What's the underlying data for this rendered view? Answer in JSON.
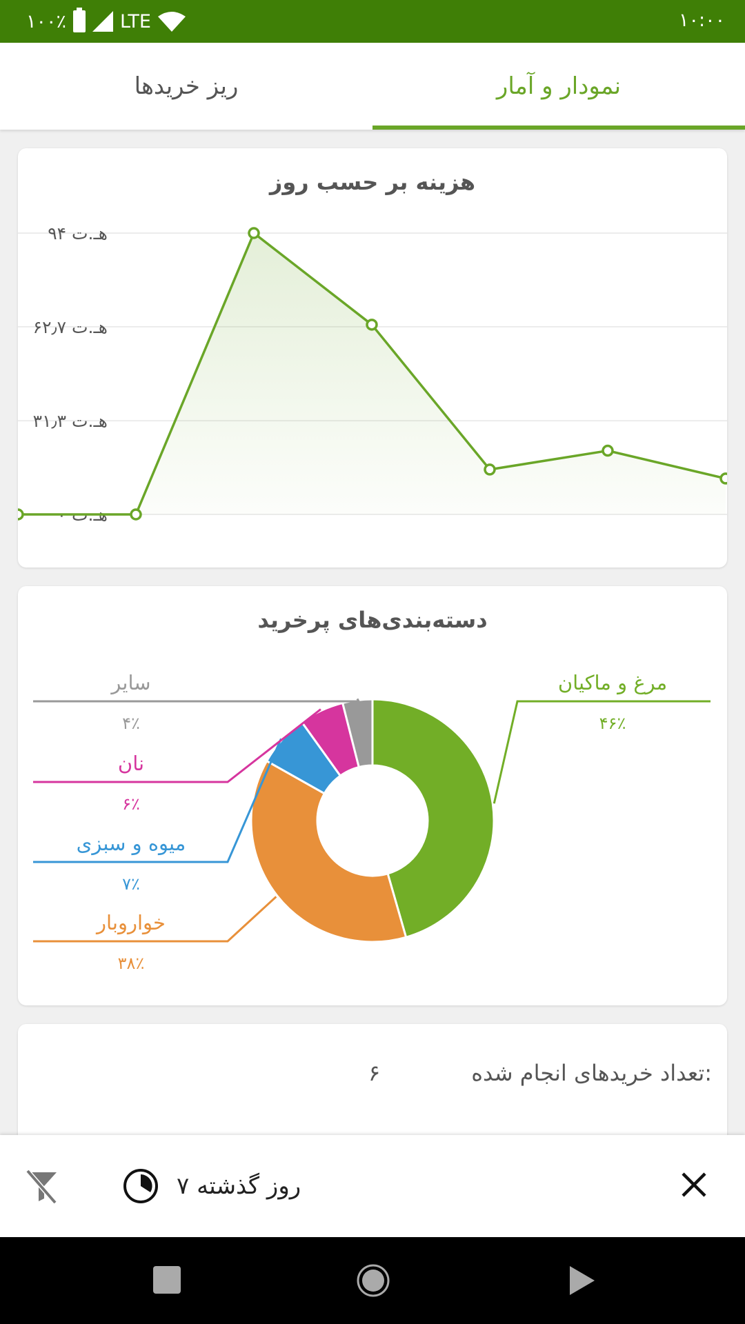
{
  "status_bar": {
    "time": "۱۰:۰۰",
    "battery": "۱۰۰٪",
    "network": "LTE"
  },
  "tabs": [
    {
      "label": "نمودار و آمار",
      "active": true
    },
    {
      "label": "ریز خریدها",
      "active": false
    }
  ],
  "line_card": {
    "title": "هزینه بر حسب روز"
  },
  "pie_card": {
    "title": "دسته‌بندی‌های پرخرید"
  },
  "chart_data": [
    {
      "type": "line",
      "title": "هزینه بر حسب روز",
      "ytick_labels": [
        "۰ هـ.ت",
        "۳۱٫۳ هـ.ت",
        "۶۲٫۷ هـ.ت",
        "۹۴ هـ.ت"
      ],
      "yticks": [
        0,
        31.3,
        62.7,
        94
      ],
      "ylim": [
        0,
        94
      ],
      "x": [
        1,
        2,
        3,
        4,
        5,
        6,
        7
      ],
      "values": [
        0,
        0,
        94,
        63.4,
        15,
        21.3,
        12
      ],
      "color": "#6aa628",
      "grid": true,
      "area_fill": true
    },
    {
      "type": "pie",
      "title": "دسته‌بندی‌های پرخرید",
      "donut": true,
      "slices": [
        {
          "label": "مرغ و ماکیان",
          "pct_label": "۴۶٪",
          "value": 46,
          "color": "#72ae27"
        },
        {
          "label": "خواروبار",
          "pct_label": "۳۸٪",
          "value": 38,
          "color": "#e8903a"
        },
        {
          "label": "میوه و سبزی",
          "pct_label": "۷٪",
          "value": 7,
          "color": "#3796d6"
        },
        {
          "label": "نان",
          "pct_label": "۶٪",
          "value": 6,
          "color": "#d6359e"
        },
        {
          "label": "سایر",
          "pct_label": "۴٪",
          "value": 4,
          "color": "#999999"
        }
      ]
    }
  ],
  "summary": {
    "label": "تعداد خریدهای انجام شده:",
    "value": "۶"
  },
  "filter_bar": {
    "period_label": "۷ روز گذشته"
  },
  "icons": {
    "filter_off": "filter-off-icon",
    "clock": "clock-icon",
    "close": "close-icon",
    "nav_back": "nav-back-icon",
    "nav_home": "nav-home-icon",
    "nav_recents": "nav-recents-icon"
  }
}
